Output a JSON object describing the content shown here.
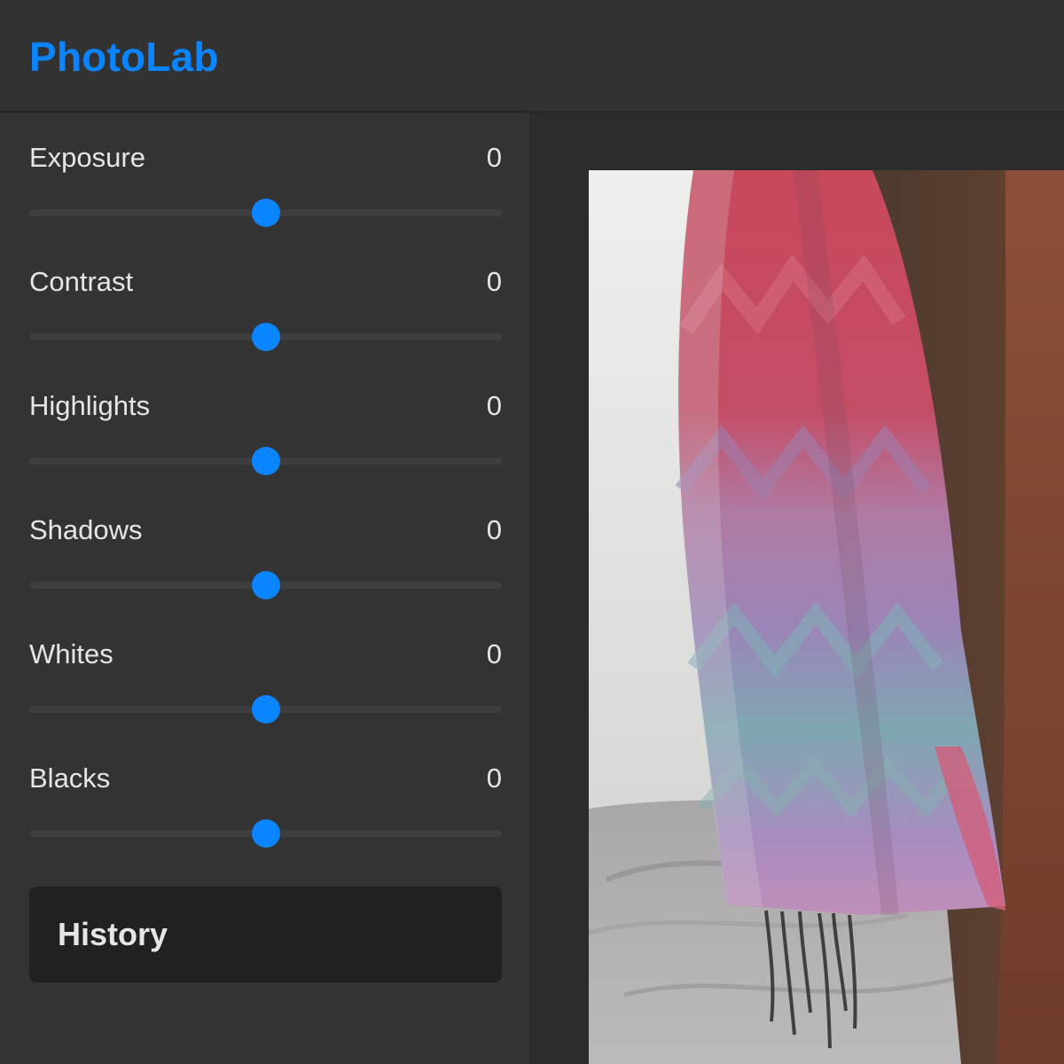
{
  "app": {
    "title": "PhotoLab"
  },
  "colors": {
    "accent": "#0a84ff",
    "panel": "#333333",
    "background": "#2b2b2b",
    "text": "#e6e6e6"
  },
  "adjustments": [
    {
      "label": "Exposure",
      "value": "0",
      "level": 0.5
    },
    {
      "label": "Contrast",
      "value": "0",
      "level": 0.5
    },
    {
      "label": "Highlights",
      "value": "0",
      "level": 0.5
    },
    {
      "label": "Shadows",
      "value": "0",
      "level": 0.5
    },
    {
      "label": "Whites",
      "value": "0",
      "level": 0.5
    },
    {
      "label": "Blacks",
      "value": "0",
      "level": 0.5
    }
  ],
  "history": {
    "label": "History"
  },
  "preview": {
    "subject": "knitted-scarf-photo"
  }
}
